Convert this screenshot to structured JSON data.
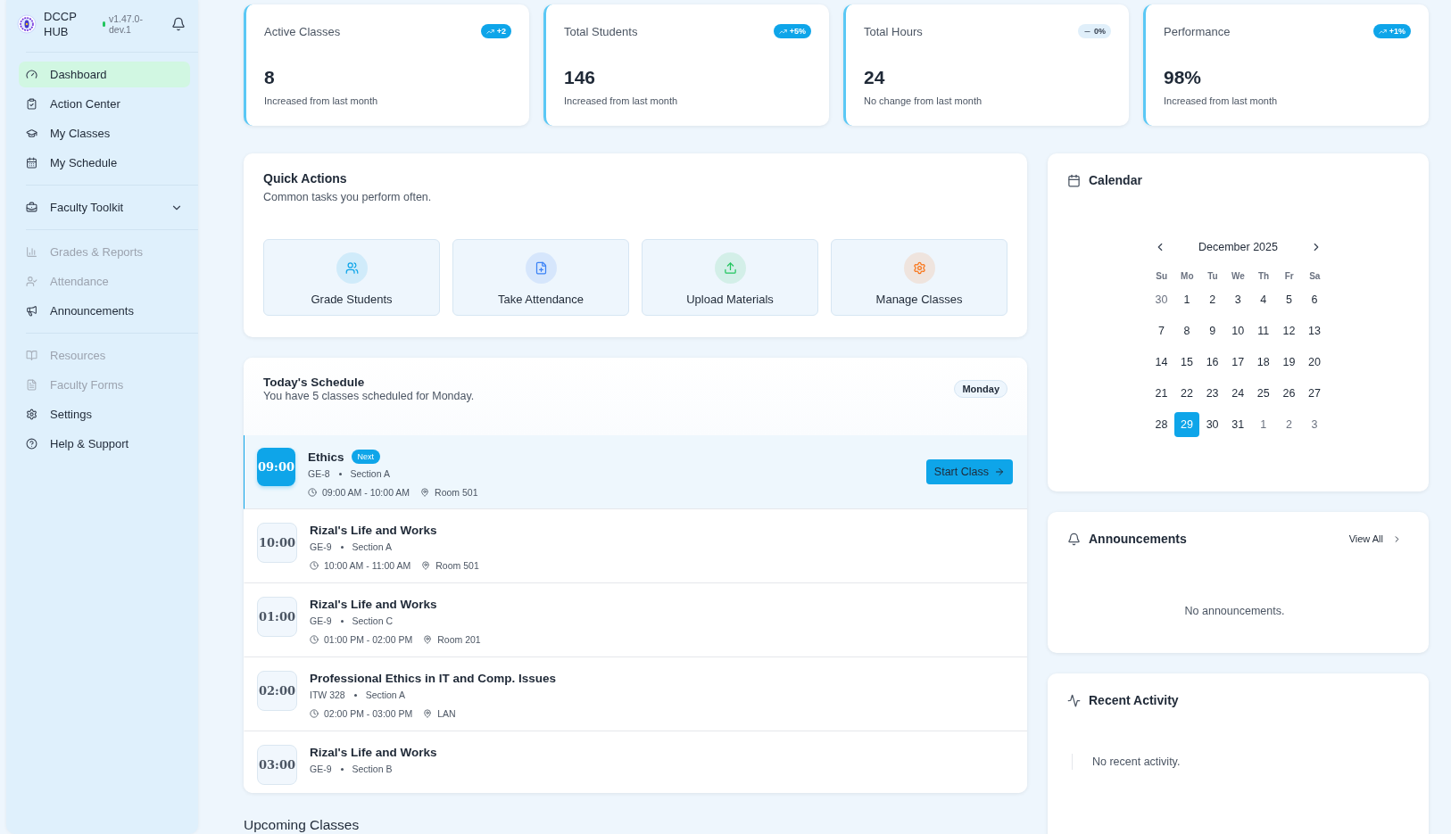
{
  "sidebar": {
    "brand": "DCCP HUB",
    "version": "v1.47.0-dev.1",
    "online": true,
    "sections": [
      [
        {
          "label": "Dashboard",
          "selected": true,
          "disabled": false
        },
        {
          "label": "Action Center",
          "selected": false,
          "disabled": false
        },
        {
          "label": "My Classes",
          "selected": false,
          "disabled": false
        },
        {
          "label": "My Schedule",
          "selected": false,
          "disabled": false
        }
      ],
      [
        {
          "label": "Faculty Toolkit",
          "selected": false,
          "disabled": false,
          "expanded": false
        }
      ],
      [
        {
          "label": "Grades & Reports",
          "selected": false,
          "disabled": true
        },
        {
          "label": "Attendance",
          "selected": false,
          "disabled": true
        },
        {
          "label": "Announcements",
          "selected": false,
          "disabled": false
        }
      ],
      [
        {
          "label": "Resources",
          "selected": false,
          "disabled": true
        },
        {
          "label": "Faculty Forms",
          "selected": false,
          "disabled": true
        },
        {
          "label": "Settings",
          "selected": false,
          "disabled": false
        },
        {
          "label": "Help & Support",
          "selected": false,
          "disabled": false
        }
      ]
    ]
  },
  "stats": [
    {
      "label": "Active Classes",
      "value": "8",
      "note": "Increased from last month",
      "badge": "+2",
      "kind": "up"
    },
    {
      "label": "Total Students",
      "value": "146",
      "note": "Increased from last month",
      "badge": "+5%",
      "kind": "up"
    },
    {
      "label": "Total Hours",
      "value": "24",
      "note": "No change from last month",
      "badge": "0%",
      "kind": "flat"
    },
    {
      "label": "Performance",
      "value": "98%",
      "note": "Increased from last month",
      "badge": "+1%",
      "kind": "up"
    }
  ],
  "quick_actions": {
    "title": "Quick Actions",
    "subtitle": "Common tasks you perform often.",
    "items": [
      {
        "label": "Grade Students",
        "color": "#0ea5e9"
      },
      {
        "label": "Take Attendance",
        "color": "#3b82f6"
      },
      {
        "label": "Upload Materials",
        "color": "#22c55e"
      },
      {
        "label": "Manage Classes",
        "color": "#f97316"
      }
    ]
  },
  "schedule": {
    "title": "Today's Schedule",
    "subtitle": "You have 5 classes scheduled for Monday.",
    "day": "Monday",
    "rows": [
      {
        "time": "09:00",
        "title": "Ethics",
        "badge": "Next",
        "code": "GE-8",
        "section": "Section A",
        "hours": "09:00 AM - 10:00 AM",
        "room": "Room 501",
        "current": true,
        "action": "Start Class"
      },
      {
        "time": "10:00",
        "title": "Rizal's Life and Works",
        "code": "GE-9",
        "section": "Section A",
        "hours": "10:00 AM - 11:00 AM",
        "room": "Room 501",
        "current": false
      },
      {
        "time": "01:00",
        "title": "Rizal's Life and Works",
        "code": "GE-9",
        "section": "Section C",
        "hours": "01:00 PM - 02:00 PM",
        "room": "Room 201",
        "current": false
      },
      {
        "time": "02:00",
        "title": "Professional Ethics in IT and Comp. Issues",
        "code": "ITW 328",
        "section": "Section A",
        "hours": "02:00 PM - 03:00 PM",
        "room": "LAN",
        "current": false
      },
      {
        "time": "03:00",
        "title": "Rizal's Life and Works",
        "code": "GE-9",
        "section": "Section B",
        "current": false
      }
    ]
  },
  "upcoming": {
    "title": "Upcoming Classes"
  },
  "calendar": {
    "title": "Calendar",
    "month": "December 2025",
    "weekdays": [
      "Su",
      "Mo",
      "Tu",
      "We",
      "Th",
      "Fr",
      "Sa"
    ],
    "weeks": [
      [
        {
          "day": "30",
          "outside": true,
          "selected": false
        },
        {
          "day": "1",
          "outside": false,
          "selected": false
        },
        {
          "day": "2",
          "outside": false,
          "selected": false
        },
        {
          "day": "3",
          "outside": false,
          "selected": false
        },
        {
          "day": "4",
          "outside": false,
          "selected": false
        },
        {
          "day": "5",
          "outside": false,
          "selected": false
        },
        {
          "day": "6",
          "outside": false,
          "selected": false
        }
      ],
      [
        {
          "day": "7",
          "outside": false,
          "selected": false
        },
        {
          "day": "8",
          "outside": false,
          "selected": false
        },
        {
          "day": "9",
          "outside": false,
          "selected": false
        },
        {
          "day": "10",
          "outside": false,
          "selected": false
        },
        {
          "day": "11",
          "outside": false,
          "selected": false
        },
        {
          "day": "12",
          "outside": false,
          "selected": false
        },
        {
          "day": "13",
          "outside": false,
          "selected": false
        }
      ],
      [
        {
          "day": "14",
          "outside": false,
          "selected": false
        },
        {
          "day": "15",
          "outside": false,
          "selected": false
        },
        {
          "day": "16",
          "outside": false,
          "selected": false
        },
        {
          "day": "17",
          "outside": false,
          "selected": false
        },
        {
          "day": "18",
          "outside": false,
          "selected": false
        },
        {
          "day": "19",
          "outside": false,
          "selected": false
        },
        {
          "day": "20",
          "outside": false,
          "selected": false
        }
      ],
      [
        {
          "day": "21",
          "outside": false,
          "selected": false
        },
        {
          "day": "22",
          "outside": false,
          "selected": false
        },
        {
          "day": "23",
          "outside": false,
          "selected": false
        },
        {
          "day": "24",
          "outside": false,
          "selected": false
        },
        {
          "day": "25",
          "outside": false,
          "selected": false
        },
        {
          "day": "26",
          "outside": false,
          "selected": false
        },
        {
          "day": "27",
          "outside": false,
          "selected": false
        }
      ],
      [
        {
          "day": "28",
          "outside": false,
          "selected": false
        },
        {
          "day": "29",
          "outside": false,
          "selected": true
        },
        {
          "day": "30",
          "outside": false,
          "selected": false
        },
        {
          "day": "31",
          "outside": false,
          "selected": false
        },
        {
          "day": "1",
          "outside": true,
          "selected": false
        },
        {
          "day": "2",
          "outside": true,
          "selected": false
        },
        {
          "day": "3",
          "outside": true,
          "selected": false
        }
      ]
    ]
  },
  "announcements": {
    "title": "Announcements",
    "link": "View All",
    "empty": "No announcements."
  },
  "recent_activity": {
    "title": "Recent Activity",
    "empty": "No recent activity."
  }
}
